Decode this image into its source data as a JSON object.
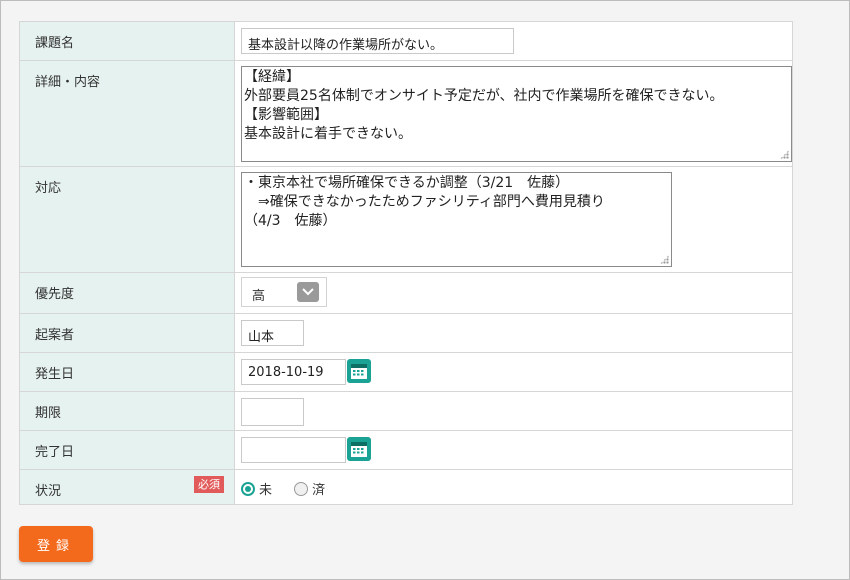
{
  "labels": {
    "title": "課題名",
    "detail": "詳細・内容",
    "response": "対応",
    "priority": "優先度",
    "proposer": "起案者",
    "occurred": "発生日",
    "deadline": "期限",
    "completed": "完了日",
    "status": "状況"
  },
  "fields": {
    "title": "基本設計以降の作業場所がない。",
    "detail": "【経緯】\n外部要員25名体制でオンサイト予定だが、社内で作業場所を確保できない。\n【影響範囲】\n基本設計に着手できない。",
    "response": "・東京本社で場所確保できるか調整（3/21　佐藤）\n　⇒確保できなかったためファシリティ部門へ費用見積り\n（4/3　佐藤）",
    "priority": "高",
    "proposer": "山本",
    "occurred": "2018-10-19",
    "deadline": "",
    "completed": ""
  },
  "status": {
    "required_badge": "必須",
    "options": [
      "未",
      "済"
    ],
    "selected": "未"
  },
  "submit_label": "登録",
  "colors": {
    "label_bg": "#e6f2ef",
    "accent": "#1aa394",
    "submit": "#f36a1d",
    "required": "#e25b5b"
  }
}
